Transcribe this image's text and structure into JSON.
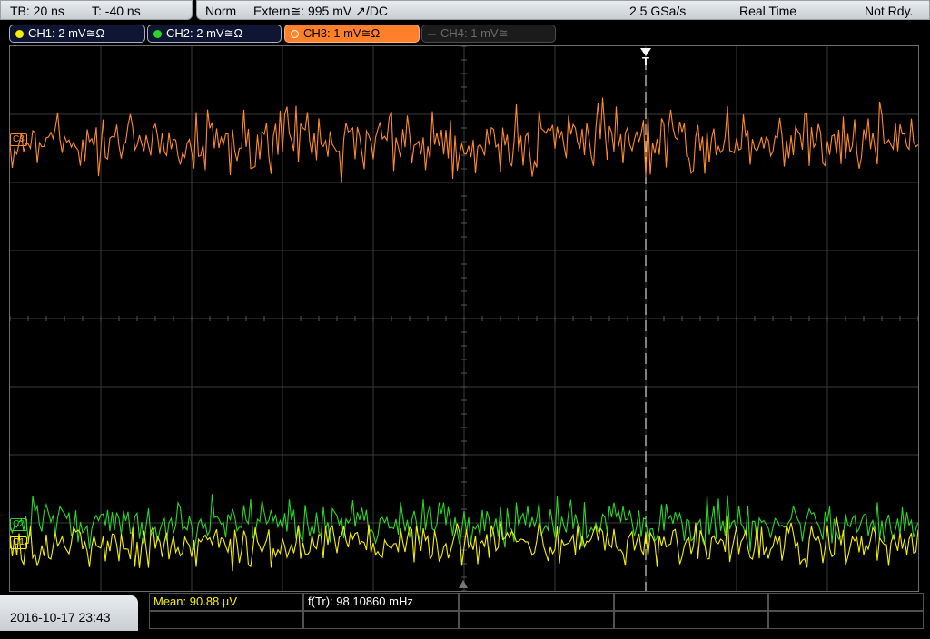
{
  "status_bar": {
    "timebase": "TB: 20 ns",
    "trigger_time": "T: -40 ns",
    "trigger_mode": "Norm",
    "trigger_source": "Extern≅: 995 mV ↗/DC",
    "sample_rate": "2.5 GSa/s",
    "acq_mode": "Real Time",
    "acq_status": "Not Rdy."
  },
  "channels": [
    {
      "label": "CH1: 2 mV≅Ω",
      "color": "#f5f000",
      "active": true
    },
    {
      "label": "CH2: 2 mV≅Ω",
      "color": "#28d728",
      "active": true
    },
    {
      "label": "CH3: 1 mV≅Ω",
      "color": "#ff8a2a",
      "active": true
    },
    {
      "label": "CH4: 1 mV≅",
      "color": "#666666",
      "active": false
    }
  ],
  "trigger_marker": {
    "label": "T"
  },
  "measurements": {
    "mean": "Mean: 90.88 µV",
    "freq": "f(Tr): 98.10860 mHz"
  },
  "datetime": "2016-10-17 23:43",
  "colors": {
    "ch1": "#f5f000",
    "ch2": "#28d728",
    "ch3": "#ff8a2a",
    "grid": "#3a3a3a",
    "panel": "#d6dade"
  },
  "chart_data": {
    "type": "line",
    "grid": "on",
    "grid_divisions": {
      "x": 10,
      "y": 8
    },
    "series": [
      {
        "name": "CH3",
        "level_div": 2.6,
        "noise_div": 0.35
      },
      {
        "name": "CH2",
        "level_div": -3.0,
        "noise_div": 0.25
      },
      {
        "name": "CH1",
        "level_div": -3.3,
        "noise_div": 0.25
      }
    ]
  }
}
